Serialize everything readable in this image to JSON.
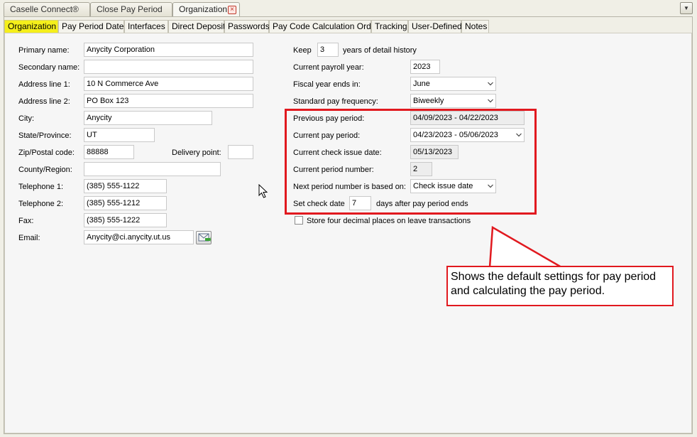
{
  "doc_tabs": [
    "Caselle Connect®",
    "Close Pay Period",
    "Organization"
  ],
  "sub_tabs": [
    "Organization",
    "Pay Period Dates",
    "Interfaces",
    "Direct Deposit",
    "Passwords",
    "Pay Code Calculation Order",
    "Tracking",
    "User-Defined",
    "Notes"
  ],
  "org": {
    "primary_name_label": "Primary name:",
    "primary_name": "Anycity Corporation",
    "secondary_name_label": "Secondary name:",
    "secondary_name": "",
    "address1_label": "Address line 1:",
    "address1": "10 N Commerce Ave",
    "address2_label": "Address line 2:",
    "address2": "PO Box 123",
    "city_label": "City:",
    "city": "Anycity",
    "state_label": "State/Province:",
    "state": "UT",
    "zip_label": "Zip/Postal code:",
    "zip": "88888",
    "delivery_label": "Delivery point:",
    "delivery": "",
    "county_label": "County/Region:",
    "county": "",
    "tel1_label": "Telephone 1:",
    "tel1": "(385) 555-1122",
    "tel2_label": "Telephone 2:",
    "tel2": "(385) 555-1212",
    "fax_label": "Fax:",
    "fax": "(385) 555-1222",
    "email_label": "Email:",
    "email": "Anycity@ci.anycity.ut.us"
  },
  "payroll": {
    "keep_label": "Keep",
    "keep_value": "3",
    "keep_suffix": "years of detail history",
    "current_year_label": "Current payroll year:",
    "current_year": "2023",
    "fiscal_end_label": "Fiscal year ends in:",
    "fiscal_end": "June",
    "frequency_label": "Standard pay frequency:",
    "frequency": "Biweekly",
    "prev_period_label": "Previous pay period:",
    "prev_period": "04/09/2023 - 04/22/2023",
    "curr_period_label": "Current pay period:",
    "curr_period": "04/23/2023 - 05/06/2023",
    "check_date_label": "Current check issue date:",
    "check_date": "05/13/2023",
    "period_num_label": "Current period number:",
    "period_num": "2",
    "next_basis_label": "Next period number is based on:",
    "next_basis": "Check issue date",
    "set_check_label": "Set check date",
    "set_check_value": "7",
    "set_check_suffix": "days after pay period ends",
    "decimal_label": "Store four decimal places on leave transactions"
  },
  "callout": {
    "text": "Shows the default settings for pay period and calculating the pay period."
  },
  "colors": {
    "highlight": "#e1191f",
    "active_tab": "#f5ef1b"
  }
}
